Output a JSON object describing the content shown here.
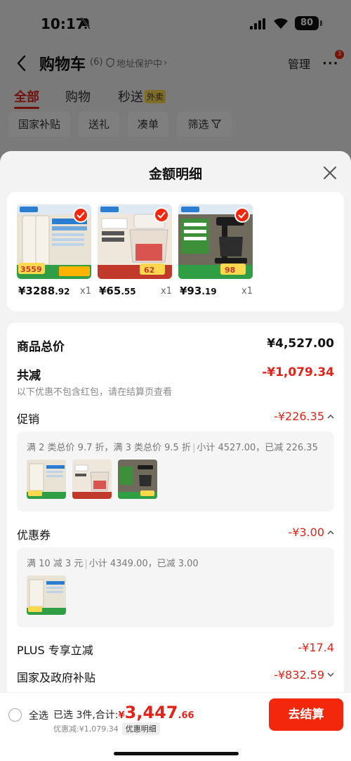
{
  "status": {
    "time": "10:17",
    "battery": "80"
  },
  "nav": {
    "title": "购物车",
    "count": "(6)",
    "address_badge": "地址保护中",
    "manage": "管理",
    "more_badge": "3"
  },
  "tabs": [
    {
      "label": "全部"
    },
    {
      "label": "购物"
    },
    {
      "label": "秒送",
      "tag": "外卖"
    }
  ],
  "chips": [
    {
      "label": "国家补贴"
    },
    {
      "label": "送礼"
    },
    {
      "label": "凑单"
    },
    {
      "label": "筛选"
    }
  ],
  "sheet": {
    "title": "金额明细"
  },
  "products": [
    {
      "name": "Midea fridge",
      "price_int": "¥3288",
      "price_dec": ".92",
      "qty": "x1",
      "img_price": "3559"
    },
    {
      "name": "Midea food chopper",
      "price_int": "¥65",
      "price_dec": ".55",
      "qty": "x1",
      "img_price": "62"
    },
    {
      "name": "Midea coffee maker",
      "price_int": "¥93",
      "price_dec": ".19",
      "qty": "x1",
      "img_price": "98"
    }
  ],
  "summary": {
    "total_label": "商品总价",
    "total_value": "¥4,527.00",
    "reduce_label": "共减",
    "reduce_value": "-¥1,079.34",
    "reduce_hint": "以下优惠不包含红包，请在结算页查看",
    "promo_label": "促销",
    "promo_value": "-¥226.35",
    "promo_desc": "满 2 类总价 9.7 折，满 3 类总价 9.5 折",
    "promo_sub": "小计 4527.00，已减 226.35",
    "coupon_label": "优惠券",
    "coupon_value": "-¥3.00",
    "coupon_desc": "满 10 减 3 元",
    "coupon_sub": "小计 4349.00，已减 3.00",
    "plus_label": "PLUS 专享立减",
    "plus_value": "-¥17.4",
    "gov_label": "国家及政府补贴",
    "gov_value": "-¥832.59"
  },
  "bottom": {
    "select_all": "全选",
    "selected": "已选 3件,合计:",
    "yen": "¥",
    "amount_int": "3,447",
    "amount_dec": ".66",
    "saved": "优惠减:¥1,079.34",
    "detail_tag": "优惠明细",
    "checkout": "去结算"
  },
  "colors": {
    "accent": "#e2231a",
    "button": "#f2270c",
    "promo_green": "#1f9e3c"
  }
}
